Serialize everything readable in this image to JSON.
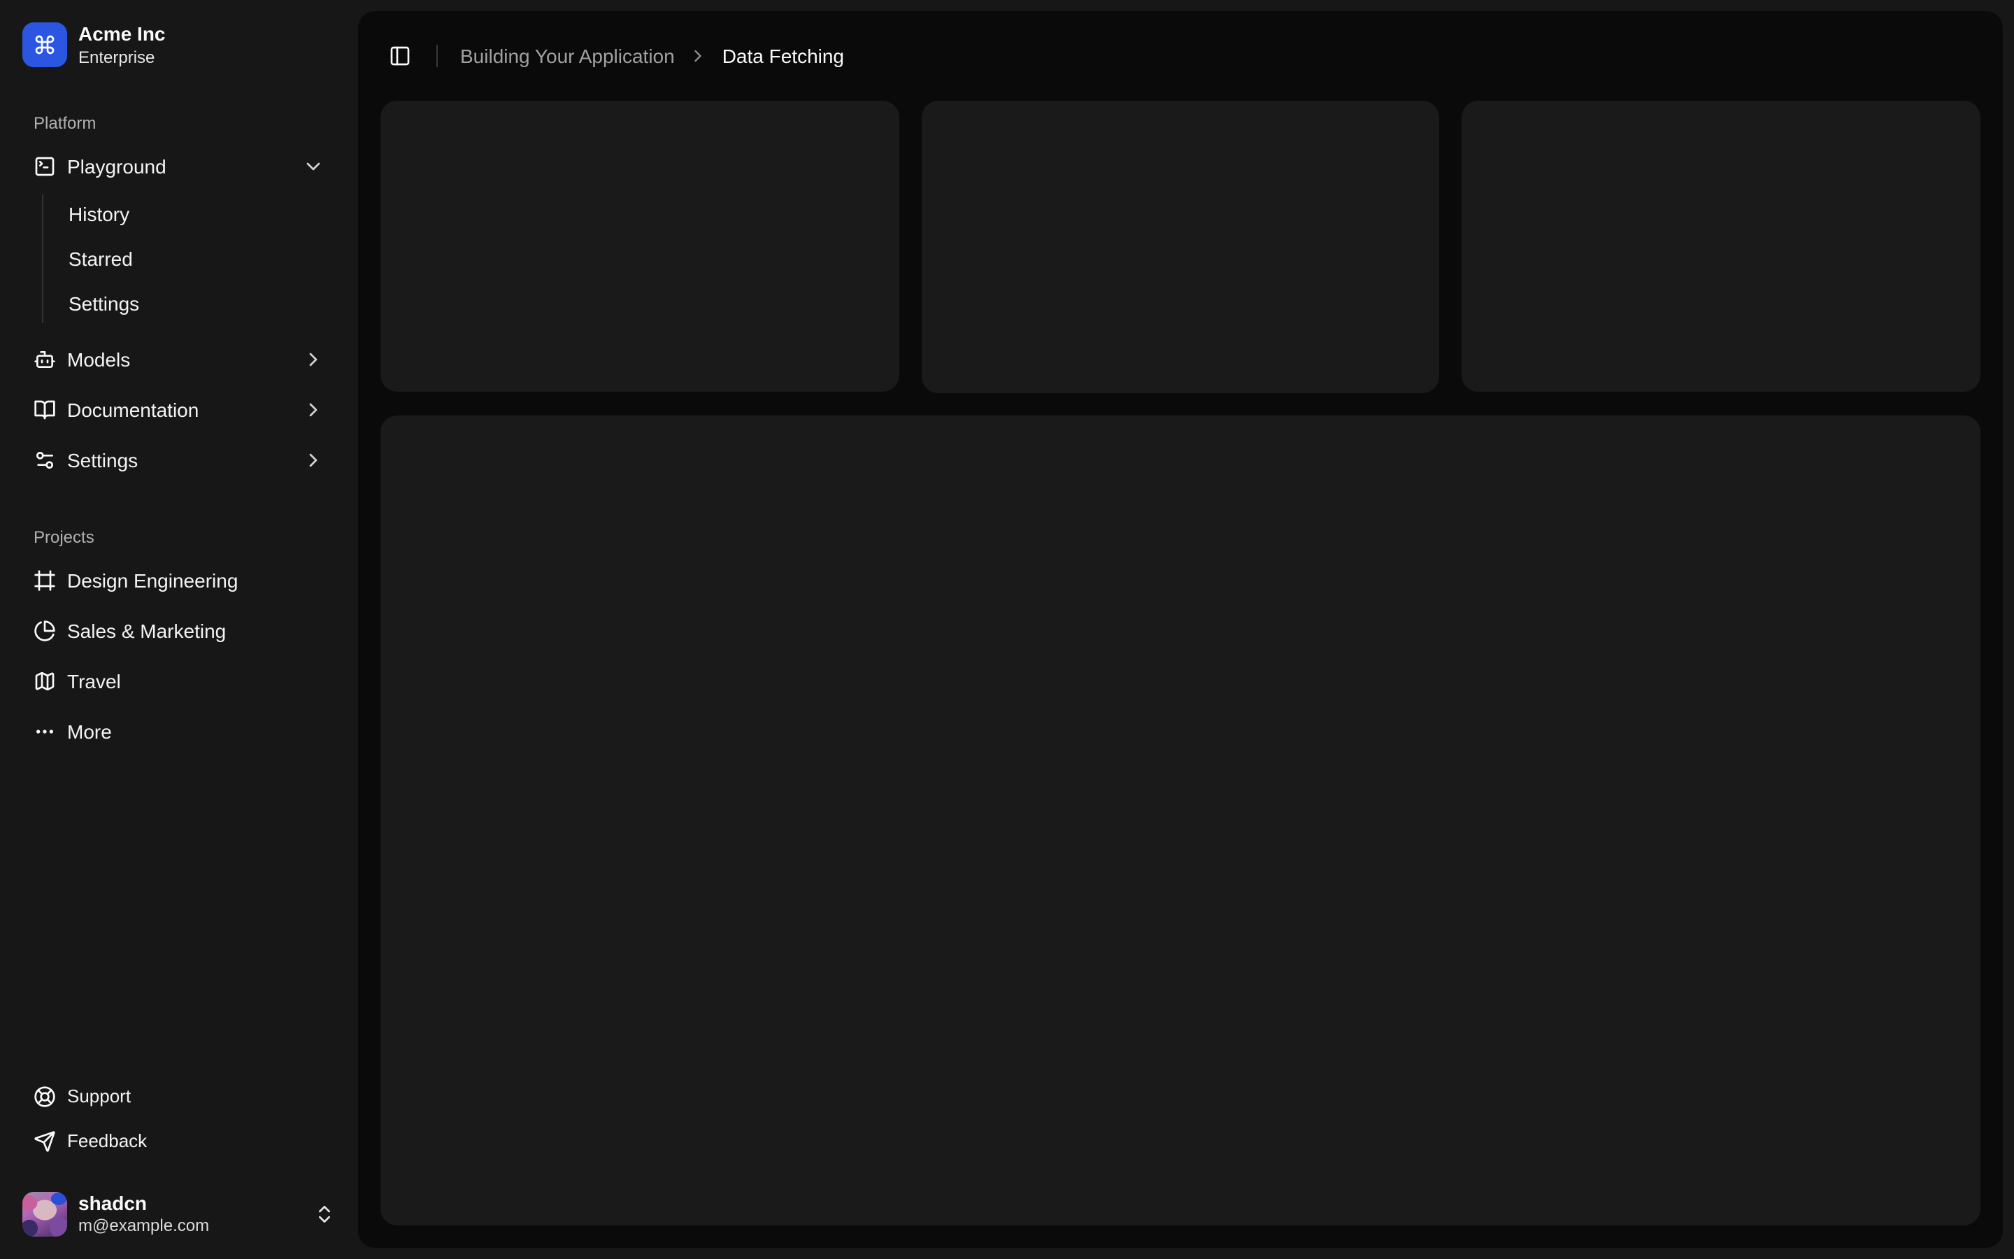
{
  "team": {
    "name": "Acme Inc",
    "plan": "Enterprise"
  },
  "nav_platform": {
    "label": "Platform",
    "items": [
      {
        "label": "Playground",
        "icon": "square-terminal-icon",
        "expanded": true,
        "children": [
          {
            "label": "History"
          },
          {
            "label": "Starred"
          },
          {
            "label": "Settings"
          }
        ]
      },
      {
        "label": "Models",
        "icon": "bot-icon"
      },
      {
        "label": "Documentation",
        "icon": "book-open-icon"
      },
      {
        "label": "Settings",
        "icon": "sliders-icon"
      }
    ]
  },
  "nav_projects": {
    "label": "Projects",
    "items": [
      {
        "label": "Design Engineering",
        "icon": "frame-icon"
      },
      {
        "label": "Sales & Marketing",
        "icon": "pie-chart-icon"
      },
      {
        "label": "Travel",
        "icon": "map-icon"
      },
      {
        "label": "More",
        "icon": "ellipsis-icon"
      }
    ]
  },
  "nav_secondary": {
    "items": [
      {
        "label": "Support",
        "icon": "life-buoy-icon"
      },
      {
        "label": "Feedback",
        "icon": "send-icon"
      }
    ]
  },
  "user": {
    "name": "shadcn",
    "email": "m@example.com"
  },
  "breadcrumb": {
    "section": "Building Your Application",
    "page": "Data Fetching"
  },
  "colors": {
    "sidebar_bg": "#171717",
    "inset_bg": "#0a0a0a",
    "card_bg": "#1a1a1a",
    "accent_blue": "#2b56e2",
    "text": "#fafafa",
    "muted_text": "#a1a1a1"
  }
}
